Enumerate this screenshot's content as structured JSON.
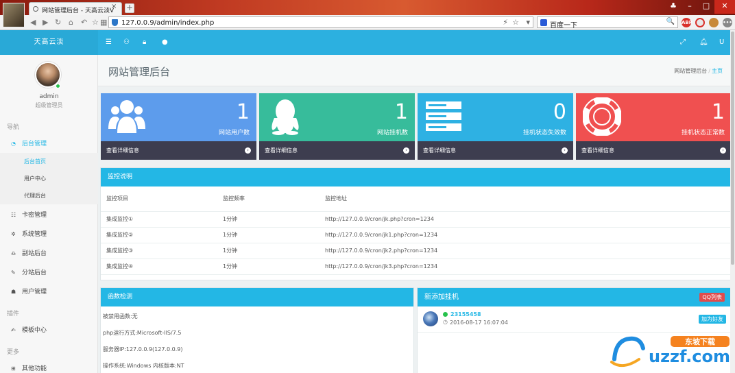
{
  "browser": {
    "tab_title": "网站管理后台 - 天高云淡V",
    "tab_close": "×",
    "new_tab": "+",
    "url": "127.0.0.9/admin/index.php",
    "search_text": "百度一下",
    "ext_abp": "ABP",
    "win_min": "–",
    "win_max": "□",
    "win_close": "✕"
  },
  "header": {
    "brand": "天高云淡",
    "icons": [
      "menu-icon",
      "user-icon",
      "lock-icon",
      "qq-icon",
      "fullscreen-icon",
      "bell-icon",
      "user-u-icon"
    ],
    "right_u": "U"
  },
  "sidebar": {
    "user_name": "admin",
    "user_role": "超级管理员",
    "section_nav": "导航",
    "section_plugin": "插件",
    "section_more": "更多",
    "items": [
      {
        "label": "后台管理",
        "icon": "dashboard-icon"
      },
      {
        "label": "卡密管理",
        "icon": "list-icon"
      },
      {
        "label": "系统管理",
        "icon": "gear-icon"
      },
      {
        "label": "副站后台",
        "icon": "bell-icon"
      },
      {
        "label": "分站后台",
        "icon": "pen-icon"
      },
      {
        "label": "用户管理",
        "icon": "users-icon"
      },
      {
        "label": "模板中心",
        "icon": "edit-icon"
      },
      {
        "label": "其他功能",
        "icon": "grid-icon"
      }
    ],
    "sub_items": [
      {
        "label": "后台首页"
      },
      {
        "label": "用户中心"
      },
      {
        "label": "代理后台"
      }
    ]
  },
  "page": {
    "title": "网站管理后台",
    "breadcrumb": [
      "网站管理后台",
      "主页"
    ],
    "crumb_sep": "/"
  },
  "stats": [
    {
      "value": "1",
      "label": "网站用户数",
      "link": "查看详细信息",
      "color": "#5d9cec",
      "icon": "users-icon"
    },
    {
      "value": "1",
      "label": "网站挂机数",
      "link": "查看详细信息",
      "color": "#37bc9b",
      "icon": "qq-icon"
    },
    {
      "value": "0",
      "label": "挂机状态失效数",
      "link": "查看详细信息",
      "color": "#2eb1e3",
      "icon": "server-icon"
    },
    {
      "value": "1",
      "label": "挂机状态正常数",
      "link": "查看详细信息",
      "color": "#f05050",
      "icon": "lifebuoy-icon"
    }
  ],
  "arrow_glyph": "›",
  "monitor": {
    "title": "监控说明",
    "columns": [
      "监控项目",
      "监控频率",
      "监控地址"
    ],
    "rows": [
      [
        "集成监控①",
        "1分钟",
        "http://127.0.0.9/cron/jk.php?cron=1234"
      ],
      [
        "集成监控②",
        "1分钟",
        "http://127.0.0.9/cron/jk1.php?cron=1234"
      ],
      [
        "集成监控③",
        "1分钟",
        "http://127.0.0.9/cron/jk2.php?cron=1234"
      ],
      [
        "集成监控④",
        "1分钟",
        "http://127.0.0.9/cron/jk3.php?cron=1234"
      ]
    ]
  },
  "func_check": {
    "title": "函数检测",
    "lines": [
      "被禁用函数:无",
      "php运行方式:Microsoft-IIS/7.5",
      "服务器IP:127.0.0.9(127.0.0.9)",
      "操作系统:Windows  内核版本:NT"
    ]
  },
  "new_bots": {
    "title": "新添加挂机",
    "qq_list_button": "QQ列表",
    "entries": [
      {
        "qq": "23155458",
        "time": "2016-08-17 16:07:04",
        "add_button": "加为好友"
      }
    ]
  },
  "watermark": {
    "text1": "东坡下载",
    "text2": "uzzf.com"
  }
}
